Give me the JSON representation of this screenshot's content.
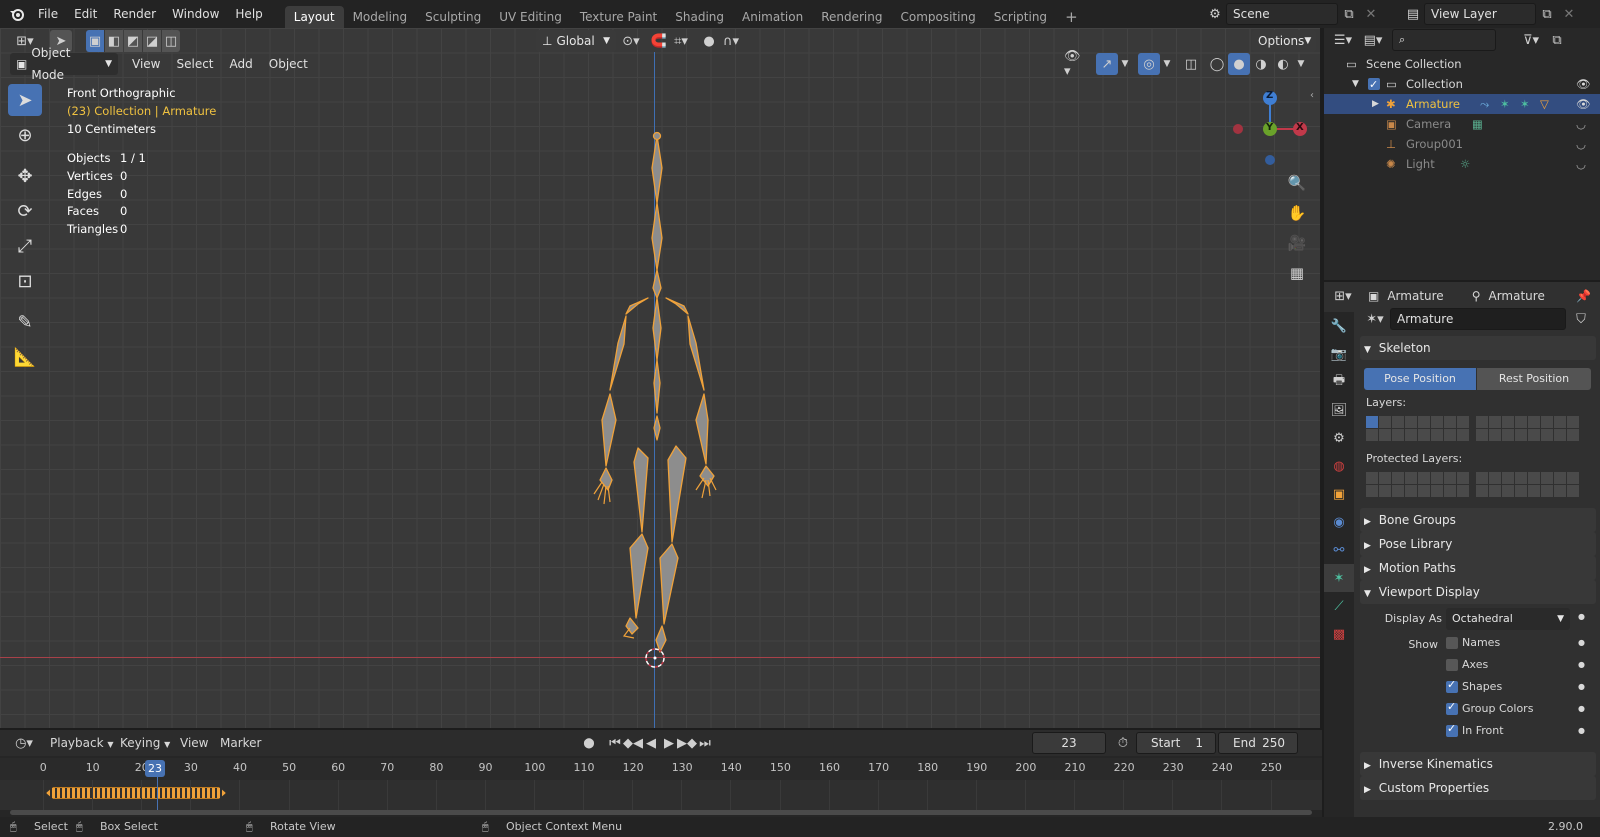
{
  "topbar": {
    "menus": [
      "File",
      "Edit",
      "Render",
      "Window",
      "Help"
    ],
    "workspaces": [
      "Layout",
      "Modeling",
      "Sculpting",
      "UV Editing",
      "Texture Paint",
      "Shading",
      "Animation",
      "Rendering",
      "Compositing",
      "Scripting"
    ],
    "active_workspace": "Layout",
    "add_tab": "+",
    "scene": "Scene",
    "view_layer": "View Layer"
  },
  "viewport": {
    "mode": "Object Mode",
    "menus": [
      "View",
      "Select",
      "Add",
      "Object"
    ],
    "transform_orientation": "Global",
    "options": "Options",
    "view_name": "Front Orthographic",
    "collection_path": "(23) Collection | Armature",
    "grid_scale": "10 Centimeters",
    "stats": [
      {
        "label": "Objects",
        "value": "1 / 1"
      },
      {
        "label": "Vertices",
        "value": "0"
      },
      {
        "label": "Edges",
        "value": "0"
      },
      {
        "label": "Faces",
        "value": "0"
      },
      {
        "label": "Triangles",
        "value": "0"
      }
    ],
    "gizmo": {
      "z": "Z",
      "y": "Y",
      "x": "X"
    },
    "colors": {
      "selected_bone": "#f0a23a",
      "x_axis": "#c1394a",
      "y_axis": "#6aa22a",
      "z_axis": "#3f7ed3",
      "active": "#4772b3"
    }
  },
  "outliner": {
    "scene_collection": "Scene Collection",
    "items": [
      {
        "name": "Collection",
        "depth": 1,
        "selected": false
      },
      {
        "name": "Armature",
        "depth": 2,
        "selected": true
      },
      {
        "name": "Camera",
        "depth": 2,
        "selected": false
      },
      {
        "name": "Group001",
        "depth": 2,
        "selected": false
      },
      {
        "name": "Light",
        "depth": 2,
        "selected": false
      }
    ]
  },
  "properties": {
    "header_object": "Armature",
    "header_data": "Armature",
    "datablock_name": "Armature",
    "skeleton": {
      "title": "Skeleton",
      "pose_position": "Pose Position",
      "rest_position": "Rest Position",
      "layers": "Layers:",
      "protected_layers": "Protected Layers:"
    },
    "panels_collapsed": [
      "Bone Groups",
      "Pose Library",
      "Motion Paths"
    ],
    "viewport_display": {
      "title": "Viewport Display",
      "display_as_label": "Display As",
      "display_as_value": "Octahedral",
      "show_label": "Show",
      "options": [
        {
          "label": "Names",
          "checked": false
        },
        {
          "label": "Axes",
          "checked": false
        },
        {
          "label": "Shapes",
          "checked": true
        },
        {
          "label": "Group Colors",
          "checked": true
        },
        {
          "label": "In Front",
          "checked": true
        }
      ]
    },
    "panels_bottom": [
      "Inverse Kinematics",
      "Custom Properties"
    ]
  },
  "timeline": {
    "menus": [
      "Playback",
      "Keying",
      "View",
      "Marker"
    ],
    "current_frame": "23",
    "start_label": "Start",
    "start": "1",
    "end_label": "End",
    "end": "250",
    "ticks": [
      "0",
      "10",
      "20",
      "30",
      "40",
      "50",
      "60",
      "70",
      "80",
      "90",
      "100",
      "110",
      "120",
      "130",
      "140",
      "150",
      "160",
      "170",
      "180",
      "190",
      "200",
      "210",
      "220",
      "230",
      "240",
      "250"
    ]
  },
  "statusbar": {
    "select": "Select",
    "box_select": "Box Select",
    "rotate_view": "Rotate View",
    "context_menu": "Object Context Menu",
    "version": "2.90.0"
  }
}
